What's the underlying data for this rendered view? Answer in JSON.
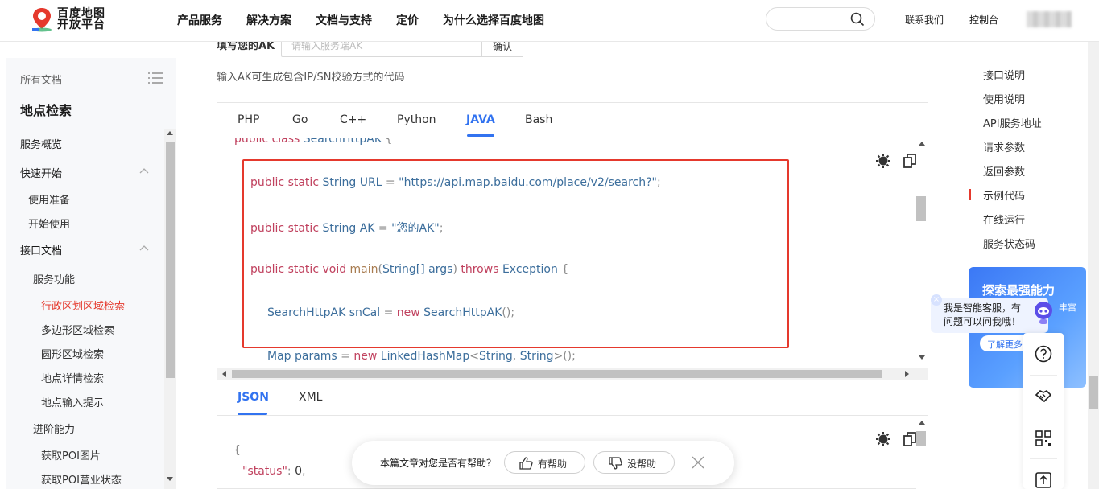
{
  "header": {
    "logo_line1": "百度地图",
    "logo_line2": "开放平台",
    "nav": [
      "产品服务",
      "解决方案",
      "文档与支持",
      "定价",
      "为什么选择百度地图"
    ],
    "search_icon": "search-icon",
    "contact": "联系我们",
    "console": "控制台"
  },
  "sidebar": {
    "all_docs": "所有文档",
    "title": "地点检索",
    "items": [
      {
        "label": "服务概览",
        "kind": "sec"
      },
      {
        "label": "快速开始",
        "kind": "sec"
      },
      {
        "label": "使用准备",
        "kind": "sub"
      },
      {
        "label": "开始使用",
        "kind": "sub"
      },
      {
        "label": "接口文档",
        "kind": "sec"
      },
      {
        "label": "服务功能",
        "kind": "group"
      },
      {
        "label": "行政区划区域检索",
        "kind": "leaf",
        "active": true
      },
      {
        "label": "多边形区域检索",
        "kind": "leaf"
      },
      {
        "label": "圆形区域检索",
        "kind": "leaf"
      },
      {
        "label": "地点详情检索",
        "kind": "leaf"
      },
      {
        "label": "地点输入提示",
        "kind": "leaf"
      },
      {
        "label": "进阶能力",
        "kind": "group"
      },
      {
        "label": "获取POI图片",
        "kind": "leaf"
      },
      {
        "label": "获取POI营业状态",
        "kind": "leaf"
      }
    ]
  },
  "ak": {
    "label": "填写您的AK",
    "placeholder": "请输入服务端AK",
    "confirm": "确认",
    "hint": "输入AK可生成包含IP/SN校验方式的代码"
  },
  "code_tabs": [
    "PHP",
    "Go",
    "C++",
    "Python",
    "JAVA",
    "Bash"
  ],
  "code_active_tab": "JAVA",
  "code_lines": {
    "l0a": "public class ",
    "l0b": "SearchHttpAK",
    "l0c": " {",
    "l1a": "public static ",
    "l1b": "String",
    "l1c": " URL",
    "l1d": " = ",
    "l1e": "\"https://api.map.baidu.com/place/v2/search?\"",
    "l1f": ";",
    "l2a": "public static ",
    "l2b": "String",
    "l2c": " AK",
    "l2d": " = ",
    "l2e": "\"您的AK\"",
    "l2f": ";",
    "l3a": "public static void ",
    "l3b": "main",
    "l3c": "(",
    "l3d": "String[]",
    "l3e": " args",
    "l3f": ") ",
    "l3g": "throws ",
    "l3h": "Exception",
    "l3i": " {",
    "l4a": "SearchHttpAK",
    "l4b": " snCal",
    "l4c": " = ",
    "l4d": "new ",
    "l4e": "SearchHttpAK",
    "l4f": "();",
    "l5a": "Map",
    "l5b": " params",
    "l5c": " = ",
    "l5d": "new ",
    "l5e": "LinkedHashMap",
    "l5f": "<",
    "l5g": "String",
    "l5h": ", ",
    "l5i": "String",
    "l5j": ">();"
  },
  "json_tabs": [
    "JSON",
    "XML"
  ],
  "json_active_tab": "JSON",
  "json_lines": {
    "brace": "{",
    "key": "\"status\"",
    "colon": ": ",
    "val": "0",
    "comma": ","
  },
  "feedback": {
    "question": "本篇文章对您是否有帮助？",
    "yes": "有帮助",
    "no": "没帮助"
  },
  "right_nav": [
    "接口说明",
    "使用说明",
    "API服务地址",
    "请求参数",
    "返回参数",
    "示例代码",
    "在线运行",
    "服务状态码"
  ],
  "right_nav_active": "示例代码",
  "banner": {
    "title": "探索最强能力",
    "sub": "丰富",
    "button": "了解更多"
  },
  "bot": {
    "text": "我是智能客服，有\n问题可以问我哦！",
    "close": "×"
  },
  "colors": {
    "accent": "#3273f0",
    "active_red": "#e5392d",
    "keyword": "#c0415e",
    "type": "#3c6e9c"
  }
}
